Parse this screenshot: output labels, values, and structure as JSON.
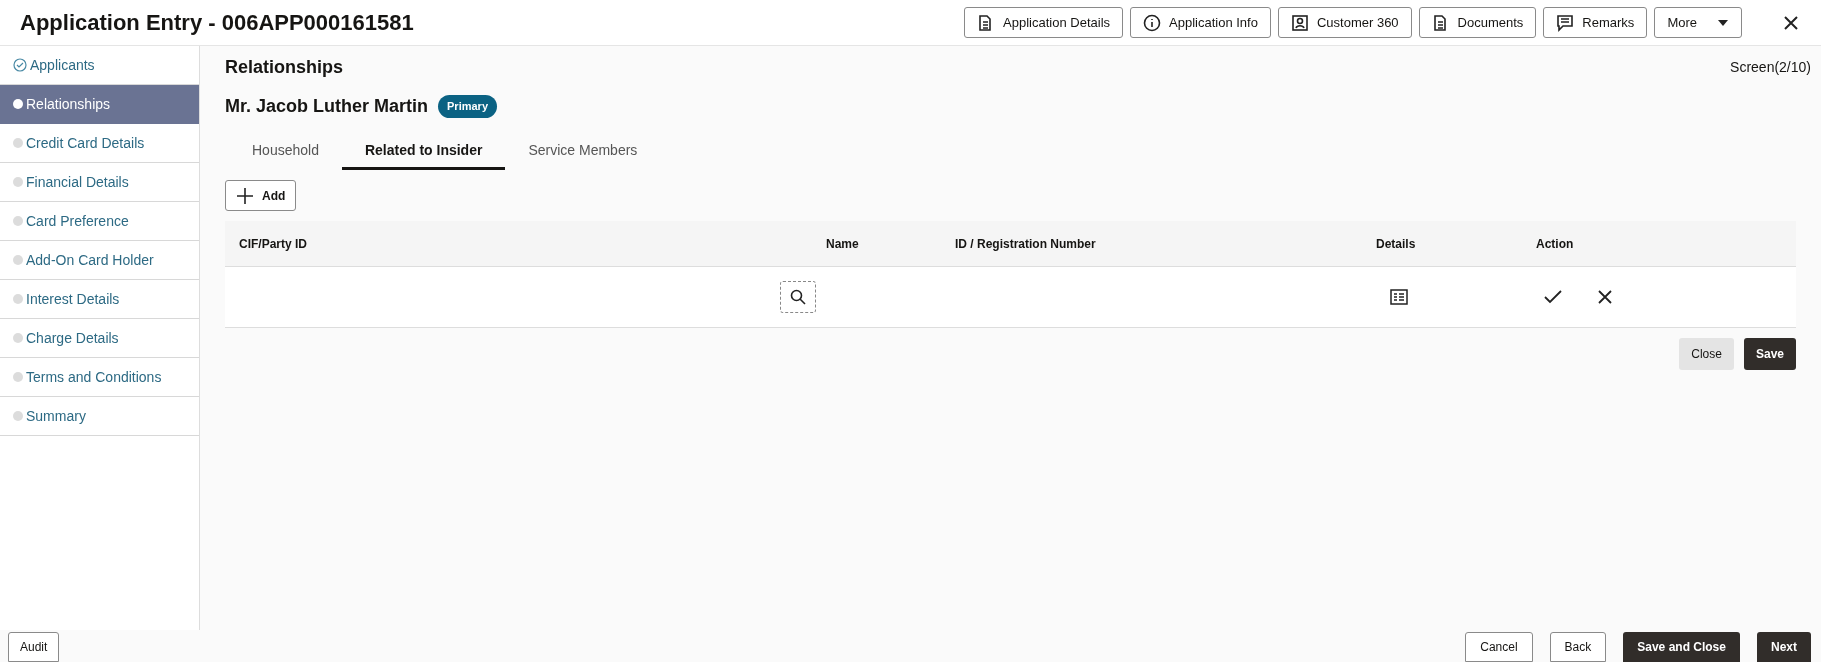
{
  "header": {
    "title": "Application Entry - 006APP000161581",
    "buttons": [
      {
        "label": "Application Details",
        "kind": "doc"
      },
      {
        "label": "Application Info",
        "kind": "info"
      },
      {
        "label": "Customer 360",
        "kind": "person"
      },
      {
        "label": "Documents",
        "kind": "doc"
      },
      {
        "label": "Remarks",
        "kind": "note"
      },
      {
        "label": "More",
        "kind": "caret"
      }
    ]
  },
  "sidebar": {
    "items": [
      {
        "label": "Applicants",
        "selected": false,
        "completed": true
      },
      {
        "label": "Relationships",
        "selected": true,
        "completed": false
      },
      {
        "label": "Credit Card Details",
        "selected": false,
        "completed": false
      },
      {
        "label": "Financial Details",
        "selected": false,
        "completed": false
      },
      {
        "label": "Card Preference",
        "selected": false,
        "completed": false
      },
      {
        "label": "Add-On Card Holder",
        "selected": false,
        "completed": false
      },
      {
        "label": "Interest Details",
        "selected": false,
        "completed": false
      },
      {
        "label": "Charge Details",
        "selected": false,
        "completed": false
      },
      {
        "label": "Terms and Conditions",
        "selected": false,
        "completed": false
      },
      {
        "label": "Summary",
        "selected": false,
        "completed": false
      }
    ]
  },
  "main": {
    "title": "Relationships",
    "screen": "Screen(2/10)",
    "applicant": "Mr. Jacob Luther Martin",
    "badge": "Primary",
    "tabs": [
      {
        "label": "Household",
        "selected": false
      },
      {
        "label": "Related to Insider",
        "selected": true
      },
      {
        "label": "Service Members",
        "selected": false
      }
    ],
    "add_button": "Add",
    "table": {
      "columns": [
        "CIF/Party ID",
        "Name",
        "ID / Registration Number",
        "Details",
        "Action"
      ]
    },
    "close_button": "Close",
    "save_button": "Save"
  },
  "footer": {
    "left": "Audit",
    "buttons": [
      {
        "label": "Cancel",
        "primary": false
      },
      {
        "label": "Back",
        "primary": false
      },
      {
        "label": "Save and Close",
        "primary": true
      },
      {
        "label": "Next",
        "primary": true
      }
    ]
  }
}
